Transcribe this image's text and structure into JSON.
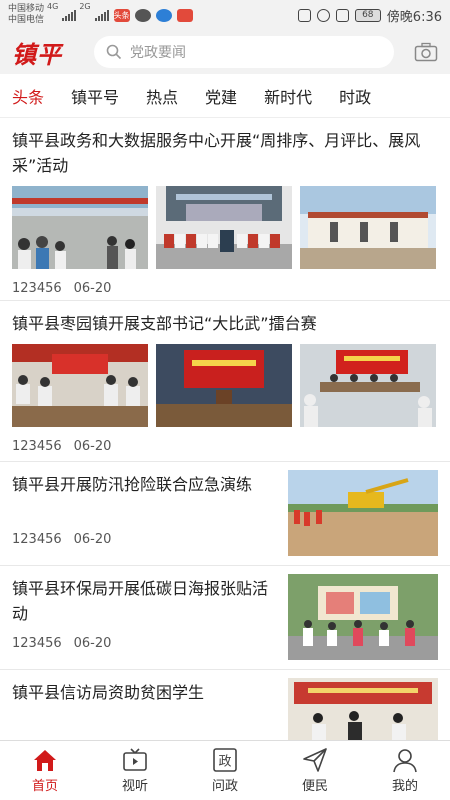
{
  "status_bar": {
    "carrier1": "中国移动",
    "carrier2": "中国电信",
    "net1": "4G",
    "net2": "2G",
    "notif_badge": "头条",
    "battery": "68",
    "time": "傍晚6:36"
  },
  "header": {
    "logo": "镇平",
    "search_placeholder": "党政要闻"
  },
  "tabs": [
    "头条",
    "镇平号",
    "热点",
    "党建",
    "新时代",
    "时政"
  ],
  "active_tab": 0,
  "news": [
    {
      "title": "镇平县政务和大数据服务中心开展“周排序、月评比、展风采”活动",
      "source": "123456",
      "date": "06-20",
      "layout": "three"
    },
    {
      "title": "镇平县枣园镇开展支部书记“大比武”擂台赛",
      "source": "123456",
      "date": "06-20",
      "layout": "three"
    },
    {
      "title": "镇平县开展防汛抢险联合应急演练",
      "source": "123456",
      "date": "06-20",
      "layout": "side"
    },
    {
      "title": "镇平县环保局开展低碳日海报张贴活动",
      "source": "123456",
      "date": "06-20",
      "layout": "side"
    },
    {
      "title": "镇平县信访局资助贫困学生",
      "source": "",
      "date": "",
      "layout": "side"
    }
  ],
  "bottom_nav": [
    {
      "label": "首页",
      "icon": "home-icon"
    },
    {
      "label": "视听",
      "icon": "tv-icon"
    },
    {
      "label": "问政",
      "icon": "zheng-icon"
    },
    {
      "label": "便民",
      "icon": "paper-plane-icon"
    },
    {
      "label": "我的",
      "icon": "user-icon"
    }
  ],
  "colors": {
    "accent": "#d11a1a",
    "background": "#f2f2f2"
  }
}
